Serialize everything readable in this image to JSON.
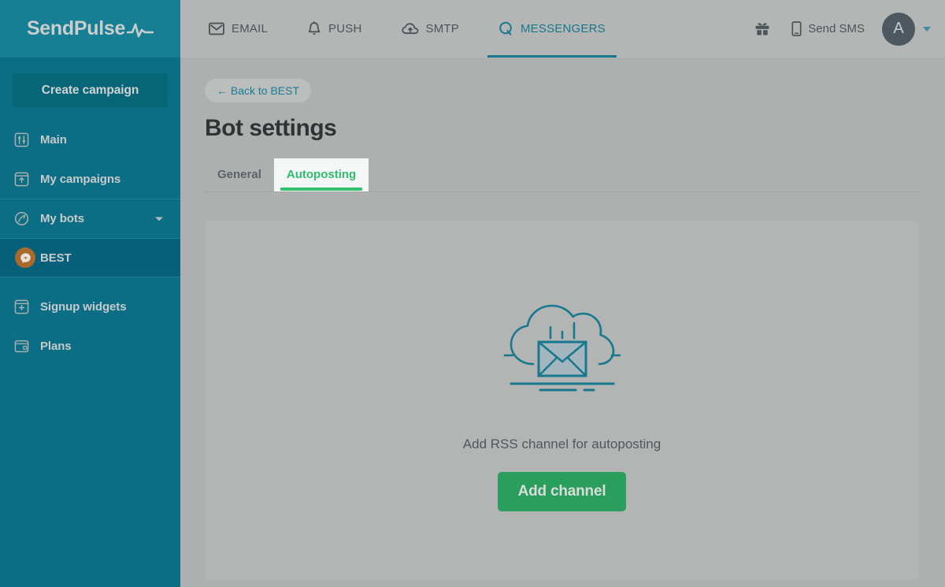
{
  "brand": {
    "name": "SendPulse",
    "logo_icon": "pulse-wave-icon"
  },
  "colors": {
    "sidebar_bg": "#0b6e85",
    "sidebar_brand_bg": "#177f94",
    "sidebar_active_bg": "#06607a",
    "page_bg": "#aeb0b0",
    "card_bg": "#b3b4b4",
    "accent_teal": "#17788e",
    "accent_green": "#2fbd6e",
    "button_green": "#2a9e5c",
    "best_badge": "#ab6a2b",
    "avatar_bg": "#4d5860",
    "illustration_stroke": "#17788e"
  },
  "sidebar": {
    "create_campaign_label": "Create campaign",
    "items": [
      {
        "label": "Main",
        "icon": "sliders-icon",
        "active": false,
        "expandable": false
      },
      {
        "label": "My campaigns",
        "icon": "campaign-box-icon",
        "active": false,
        "expandable": false
      },
      {
        "label": "My bots",
        "icon": "bot-circle-icon",
        "active": false,
        "expandable": true
      },
      {
        "label": "BEST",
        "icon": "messenger-badge-icon",
        "active": true,
        "expandable": false
      },
      {
        "label": "Signup widgets",
        "icon": "widget-plus-icon",
        "active": false,
        "expandable": false
      },
      {
        "label": "Plans",
        "icon": "plans-card-icon",
        "active": false,
        "expandable": false
      }
    ]
  },
  "header": {
    "nav": [
      {
        "label": "EMAIL",
        "icon": "envelope-icon",
        "active": false
      },
      {
        "label": "PUSH",
        "icon": "bell-icon",
        "active": false
      },
      {
        "label": "SMTP",
        "icon": "cloud-up-icon",
        "active": false
      },
      {
        "label": "MESSENGERS",
        "icon": "speech-bubble-q-icon",
        "active": true
      }
    ],
    "gift_icon": "gift-icon",
    "send_sms_label": "Send SMS",
    "send_sms_icon": "mobile-phone-icon",
    "avatar_initial": "A"
  },
  "content": {
    "back_link": "← Back to BEST",
    "page_title": "Bot settings",
    "tabs": [
      {
        "label": "General",
        "active": false
      },
      {
        "label": "Autoposting",
        "active": true
      }
    ],
    "empty_state": {
      "illustration": "cloud-envelope-rss-icon",
      "message": "Add RSS channel for autoposting",
      "button_label": "Add channel"
    }
  }
}
